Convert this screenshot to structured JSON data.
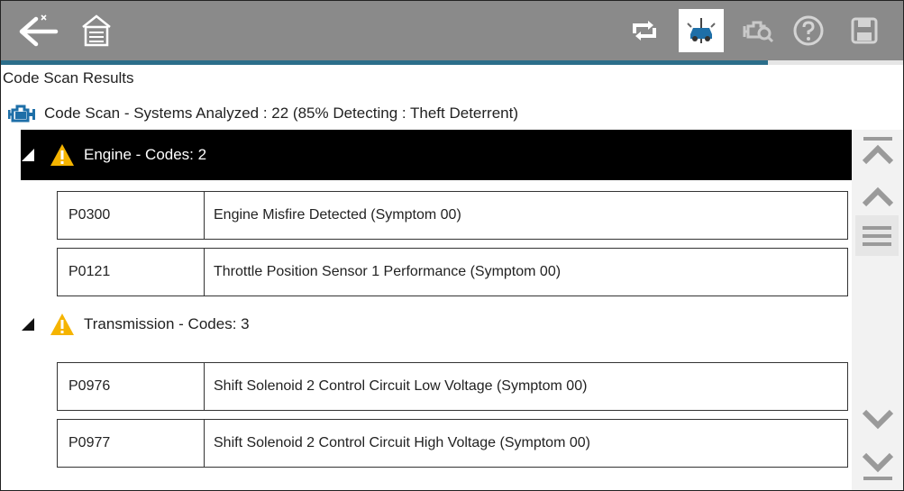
{
  "screen": {
    "title": "Code Scan Results",
    "summary": "Code Scan - Systems Analyzed : 22  (85% Detecting : Theft Deterrent)",
    "scan_progress_percent": 85
  },
  "toolbar": {
    "icons": [
      "back-icon",
      "home-icon",
      "sync-icon",
      "vehicle-scan-icon",
      "engine-search-icon",
      "help-icon",
      "save-icon"
    ]
  },
  "groups": [
    {
      "label": "Engine - Codes: 2",
      "selected": true,
      "codes": [
        {
          "code": "P0300",
          "description": "Engine Misfire Detected (Symptom 00)"
        },
        {
          "code": "P0121",
          "description": "Throttle Position Sensor 1 Performance (Symptom 00)"
        }
      ]
    },
    {
      "label": "Transmission - Codes: 3",
      "selected": false,
      "codes": [
        {
          "code": "P0976",
          "description": "Shift Solenoid 2 Control Circuit Low Voltage (Symptom 00)"
        },
        {
          "code": "P0977",
          "description": "Shift Solenoid 2 Control Circuit High Voltage (Symptom 00)"
        }
      ]
    }
  ],
  "colors": {
    "toolbar_bg": "#8a8a8a",
    "selected_row_bg": "#000000",
    "warning": "#f5b400",
    "scan_icon_blue": "#1e6fa8",
    "progress": "#2c6e8a"
  }
}
